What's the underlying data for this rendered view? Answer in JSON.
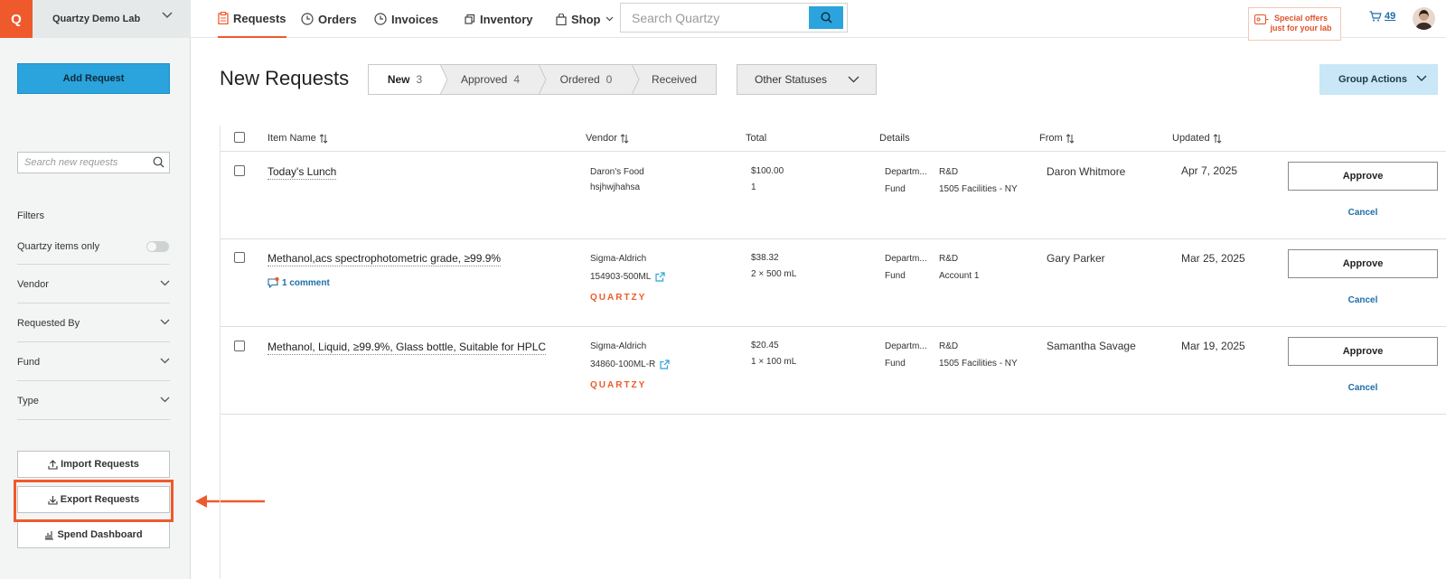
{
  "topbar": {
    "logo_letter": "Q",
    "lab_name": "Quartzy Demo Lab",
    "nav": [
      {
        "label": "Requests",
        "icon": "clipboard-icon"
      },
      {
        "label": "Orders",
        "icon": "clock-icon"
      },
      {
        "label": "Invoices",
        "icon": "clock-icon"
      },
      {
        "label": "Inventory",
        "icon": "boxes-icon"
      },
      {
        "label": "Shop",
        "icon": "bag-icon"
      }
    ],
    "search_placeholder": "Search Quartzy",
    "offers_line1": "Special offers",
    "offers_line2": "just for your lab",
    "cart_count": "49"
  },
  "sidebar": {
    "add_request": "Add Request",
    "search_placeholder": "Search new requests",
    "filters_title": "Filters",
    "quartzy_only": "Quartzy items only",
    "filters": [
      "Vendor",
      "Requested By",
      "Fund",
      "Type"
    ],
    "import": "Import Requests",
    "export": "Export Requests",
    "spend": "Spend Dashboard"
  },
  "main": {
    "title": "New Requests",
    "tabs": [
      {
        "label": "New",
        "count": "3"
      },
      {
        "label": "Approved",
        "count": "4"
      },
      {
        "label": "Ordered",
        "count": "0"
      },
      {
        "label": "Received",
        "count": ""
      }
    ],
    "other_statuses": "Other Statuses",
    "group_actions": "Group Actions",
    "columns": {
      "item_name": "Item Name",
      "vendor": "Vendor",
      "total": "Total",
      "details": "Details",
      "from": "From",
      "updated": "Updated"
    },
    "detail_labels": {
      "department": "Departm...",
      "fund": "Fund"
    },
    "approve_label": "Approve",
    "cancel_label": "Cancel",
    "quartzy_mark": "QUARTZY",
    "rows": [
      {
        "item": "Today's Lunch",
        "comment": "",
        "vendor": "Daron's Food",
        "catalog": "hsjhwjhahsa",
        "total": "$100.00",
        "qty": "1",
        "department": "R&D",
        "fund": "1505 Facilities - NY",
        "from": "Daron Whitmore",
        "updated": "Apr 7, 2025"
      },
      {
        "item": "Methanol,acs spectrophotometric grade, ≥99.9%",
        "comment": "1 comment",
        "vendor": "Sigma-Aldrich",
        "catalog": "154903-500ML",
        "total": "$38.32",
        "qty": "2 × 500 mL",
        "department": "R&D",
        "fund": "Account 1",
        "from": "Gary Parker",
        "updated": "Mar 25, 2025"
      },
      {
        "item": "Methanol, Liquid, ≥99.9%, Glass bottle, Suitable for HPLC",
        "comment": "",
        "vendor": "Sigma-Aldrich",
        "catalog": "34860-100ML-R",
        "total": "$20.45",
        "qty": "1 × 100 mL",
        "department": "R&D",
        "fund": "1505 Facilities - NY",
        "from": "Samantha Savage",
        "updated": "Mar 19, 2025"
      }
    ]
  },
  "colors": {
    "accent": "#ee5a2b",
    "primary": "#2ba3dc",
    "link": "#1d6ea8"
  }
}
